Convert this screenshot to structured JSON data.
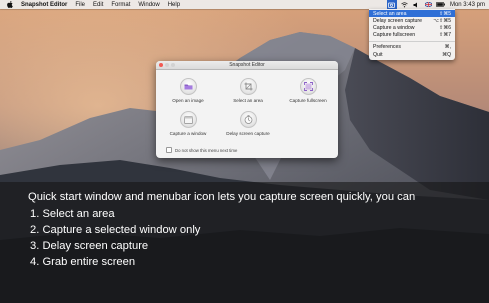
{
  "menubar": {
    "apple_icon": "apple-logo-icon",
    "app_name": "Snapshot Editor",
    "items": [
      "File",
      "Edit",
      "Format",
      "Window",
      "Help"
    ],
    "status_icons": [
      "screen-capture-icon",
      "wifi-icon",
      "speaker-icon",
      "flag-icon",
      "battery-icon"
    ],
    "clock": "Mon 3:43 pm"
  },
  "status_menu": {
    "items": [
      {
        "label": "Select an area",
        "shortcut": "⇧⌘5",
        "highlighted": true
      },
      {
        "label": "Delay screen capture",
        "shortcut": "⌥⇧⌘5",
        "highlighted": false
      },
      {
        "label": "Capture a window",
        "shortcut": "⇧⌘6",
        "highlighted": false
      },
      {
        "label": "Capture fullscreen",
        "shortcut": "⇧⌘7",
        "highlighted": false
      }
    ],
    "secondary": [
      {
        "label": "Preferences",
        "shortcut": "⌘,"
      },
      {
        "label": "Quit",
        "shortcut": "⌘Q"
      }
    ],
    "highlight_color": "#2f6fd6"
  },
  "editor": {
    "title": "Snapshot Editor",
    "actions": {
      "open_image": "Open an image",
      "select_area": "Select an area",
      "capture_fullscreen": "Capture fullscreen",
      "capture_window": "Capture a window",
      "delay_capture": "Delay screen capture"
    },
    "dont_show": "Do not show this menu next time"
  },
  "caption": {
    "intro": "Quick start window and menubar icon lets you capture screen quickly, you can",
    "steps": [
      "1. Select an area",
      "2. Capture a selected window only",
      "3. Delay screen capture",
      "4. Grab entire screen"
    ]
  }
}
